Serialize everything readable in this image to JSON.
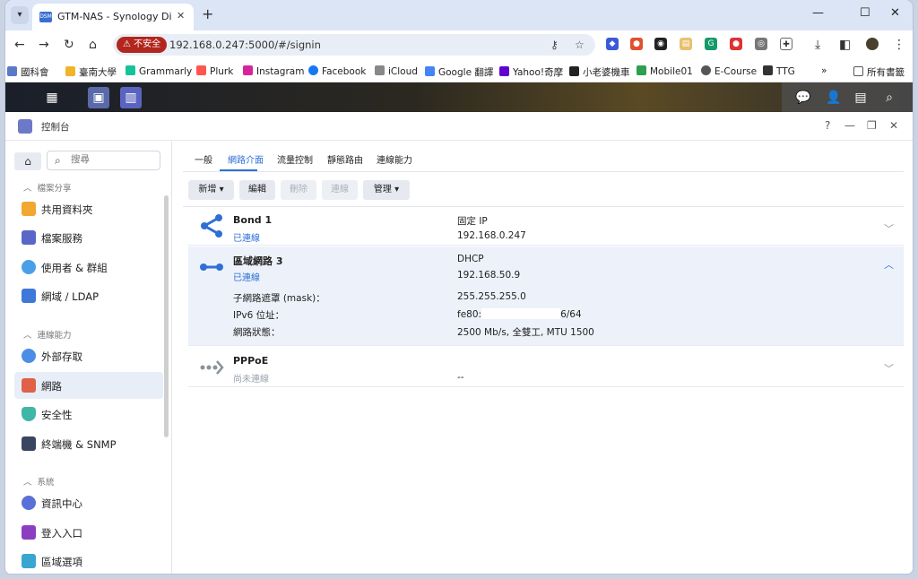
{
  "browser": {
    "tab_title": "GTM-NAS - Synology DiskSta",
    "tab_favicon": "DSM",
    "insecure_label": "不安全",
    "url": "192.168.0.247:5000/#/signin"
  },
  "bookmarks": [
    {
      "label": "國科會",
      "color": "#5b79c8"
    },
    {
      "label": "臺南大學",
      "color": "#f0b429"
    },
    {
      "label": "Grammarly",
      "color": "#15c39a"
    },
    {
      "label": "Plurk",
      "color": "#ff574d"
    },
    {
      "label": "Instagram",
      "color": "#d6249f"
    },
    {
      "label": "Facebook",
      "color": "#1877f2"
    },
    {
      "label": "iCloud",
      "color": "#888888"
    },
    {
      "label": "Google 翻譯",
      "color": "#4285f4"
    },
    {
      "label": "Yahoo!奇摩",
      "color": "#6001d2"
    },
    {
      "label": "小老婆機車",
      "color": "#222222"
    },
    {
      "label": "Mobile01",
      "color": "#2e9e4f"
    },
    {
      "label": "E-Course",
      "color": "#555555"
    },
    {
      "label": "TTG",
      "color": "#333333"
    },
    {
      "label": "所有書籤",
      "color": "#555555"
    }
  ],
  "window": {
    "title": "控制台"
  },
  "sidebar": {
    "search_placeholder": "搜尋",
    "groups": [
      "檔案分享",
      "連線能力",
      "系統"
    ],
    "items": [
      {
        "label": "共用資料夾",
        "color": "#f0a830"
      },
      {
        "label": "檔案服務",
        "color": "#5a66c8"
      },
      {
        "label": "使用者 & 群組",
        "color": "#4aa0e8"
      },
      {
        "label": "網域 / LDAP",
        "color": "#3e78d8"
      },
      {
        "label": "外部存取",
        "color": "#4c8ee6"
      },
      {
        "label": "網路",
        "color": "#e0604a"
      },
      {
        "label": "安全性",
        "color": "#3fb6a8"
      },
      {
        "label": "終端機 & SNMP",
        "color": "#3a4660"
      },
      {
        "label": "資訊中心",
        "color": "#5b6fd8"
      },
      {
        "label": "登入入口",
        "color": "#8b3fc0"
      },
      {
        "label": "區域選項",
        "color": "#38a6d0"
      }
    ]
  },
  "tabs": [
    "一般",
    "網路介面",
    "流量控制",
    "靜態路由",
    "連線能力"
  ],
  "toolbar": {
    "add": "新增",
    "edit": "編輯",
    "delete": "刪除",
    "connect": "連線",
    "manage": "管理"
  },
  "interfaces": [
    {
      "name": "Bond 1",
      "status": "已連線",
      "type": "固定 IP",
      "ip": "192.168.0.247"
    },
    {
      "name": "區域網路 3",
      "status": "已連線",
      "type": "DHCP",
      "ip": "192.168.50.9",
      "details": [
        {
          "label": "子網路遮罩 (mask)：",
          "value": "255.255.255.0"
        },
        {
          "label": "IPv6 位址：",
          "value_prefix": "fe80:",
          "value_suffix": "6/64"
        },
        {
          "label": "網路狀態：",
          "value": "2500 Mb/s, 全雙工, MTU 1500"
        }
      ]
    },
    {
      "name": "PPPoE",
      "status": "尚未連線",
      "type": "",
      "ip": "--"
    }
  ],
  "colors": {
    "accent": "#2f6fd6",
    "icon_blue": "#2f6fd6",
    "icon_gray": "#8a929c"
  }
}
